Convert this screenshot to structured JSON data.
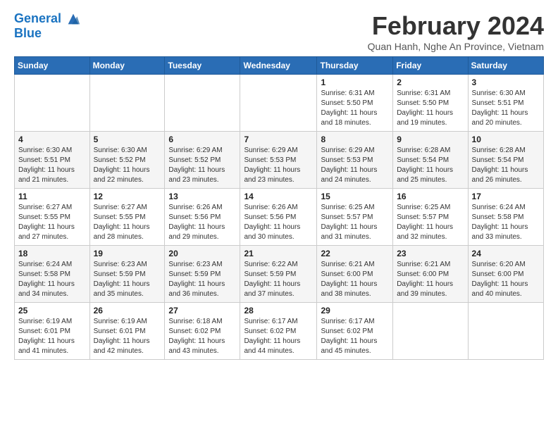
{
  "header": {
    "logo_line1": "General",
    "logo_line2": "Blue",
    "title": "February 2024",
    "subtitle": "Quan Hanh, Nghe An Province, Vietnam"
  },
  "days_of_week": [
    "Sunday",
    "Monday",
    "Tuesday",
    "Wednesday",
    "Thursday",
    "Friday",
    "Saturday"
  ],
  "weeks": [
    [
      {
        "day": "",
        "info": ""
      },
      {
        "day": "",
        "info": ""
      },
      {
        "day": "",
        "info": ""
      },
      {
        "day": "",
        "info": ""
      },
      {
        "day": "1",
        "info": "Sunrise: 6:31 AM\nSunset: 5:50 PM\nDaylight: 11 hours and 18 minutes."
      },
      {
        "day": "2",
        "info": "Sunrise: 6:31 AM\nSunset: 5:50 PM\nDaylight: 11 hours and 19 minutes."
      },
      {
        "day": "3",
        "info": "Sunrise: 6:30 AM\nSunset: 5:51 PM\nDaylight: 11 hours and 20 minutes."
      }
    ],
    [
      {
        "day": "4",
        "info": "Sunrise: 6:30 AM\nSunset: 5:51 PM\nDaylight: 11 hours and 21 minutes."
      },
      {
        "day": "5",
        "info": "Sunrise: 6:30 AM\nSunset: 5:52 PM\nDaylight: 11 hours and 22 minutes."
      },
      {
        "day": "6",
        "info": "Sunrise: 6:29 AM\nSunset: 5:52 PM\nDaylight: 11 hours and 23 minutes."
      },
      {
        "day": "7",
        "info": "Sunrise: 6:29 AM\nSunset: 5:53 PM\nDaylight: 11 hours and 23 minutes."
      },
      {
        "day": "8",
        "info": "Sunrise: 6:29 AM\nSunset: 5:53 PM\nDaylight: 11 hours and 24 minutes."
      },
      {
        "day": "9",
        "info": "Sunrise: 6:28 AM\nSunset: 5:54 PM\nDaylight: 11 hours and 25 minutes."
      },
      {
        "day": "10",
        "info": "Sunrise: 6:28 AM\nSunset: 5:54 PM\nDaylight: 11 hours and 26 minutes."
      }
    ],
    [
      {
        "day": "11",
        "info": "Sunrise: 6:27 AM\nSunset: 5:55 PM\nDaylight: 11 hours and 27 minutes."
      },
      {
        "day": "12",
        "info": "Sunrise: 6:27 AM\nSunset: 5:55 PM\nDaylight: 11 hours and 28 minutes."
      },
      {
        "day": "13",
        "info": "Sunrise: 6:26 AM\nSunset: 5:56 PM\nDaylight: 11 hours and 29 minutes."
      },
      {
        "day": "14",
        "info": "Sunrise: 6:26 AM\nSunset: 5:56 PM\nDaylight: 11 hours and 30 minutes."
      },
      {
        "day": "15",
        "info": "Sunrise: 6:25 AM\nSunset: 5:57 PM\nDaylight: 11 hours and 31 minutes."
      },
      {
        "day": "16",
        "info": "Sunrise: 6:25 AM\nSunset: 5:57 PM\nDaylight: 11 hours and 32 minutes."
      },
      {
        "day": "17",
        "info": "Sunrise: 6:24 AM\nSunset: 5:58 PM\nDaylight: 11 hours and 33 minutes."
      }
    ],
    [
      {
        "day": "18",
        "info": "Sunrise: 6:24 AM\nSunset: 5:58 PM\nDaylight: 11 hours and 34 minutes."
      },
      {
        "day": "19",
        "info": "Sunrise: 6:23 AM\nSunset: 5:59 PM\nDaylight: 11 hours and 35 minutes."
      },
      {
        "day": "20",
        "info": "Sunrise: 6:23 AM\nSunset: 5:59 PM\nDaylight: 11 hours and 36 minutes."
      },
      {
        "day": "21",
        "info": "Sunrise: 6:22 AM\nSunset: 5:59 PM\nDaylight: 11 hours and 37 minutes."
      },
      {
        "day": "22",
        "info": "Sunrise: 6:21 AM\nSunset: 6:00 PM\nDaylight: 11 hours and 38 minutes."
      },
      {
        "day": "23",
        "info": "Sunrise: 6:21 AM\nSunset: 6:00 PM\nDaylight: 11 hours and 39 minutes."
      },
      {
        "day": "24",
        "info": "Sunrise: 6:20 AM\nSunset: 6:00 PM\nDaylight: 11 hours and 40 minutes."
      }
    ],
    [
      {
        "day": "25",
        "info": "Sunrise: 6:19 AM\nSunset: 6:01 PM\nDaylight: 11 hours and 41 minutes."
      },
      {
        "day": "26",
        "info": "Sunrise: 6:19 AM\nSunset: 6:01 PM\nDaylight: 11 hours and 42 minutes."
      },
      {
        "day": "27",
        "info": "Sunrise: 6:18 AM\nSunset: 6:02 PM\nDaylight: 11 hours and 43 minutes."
      },
      {
        "day": "28",
        "info": "Sunrise: 6:17 AM\nSunset: 6:02 PM\nDaylight: 11 hours and 44 minutes."
      },
      {
        "day": "29",
        "info": "Sunrise: 6:17 AM\nSunset: 6:02 PM\nDaylight: 11 hours and 45 minutes."
      },
      {
        "day": "",
        "info": ""
      },
      {
        "day": "",
        "info": ""
      }
    ]
  ]
}
